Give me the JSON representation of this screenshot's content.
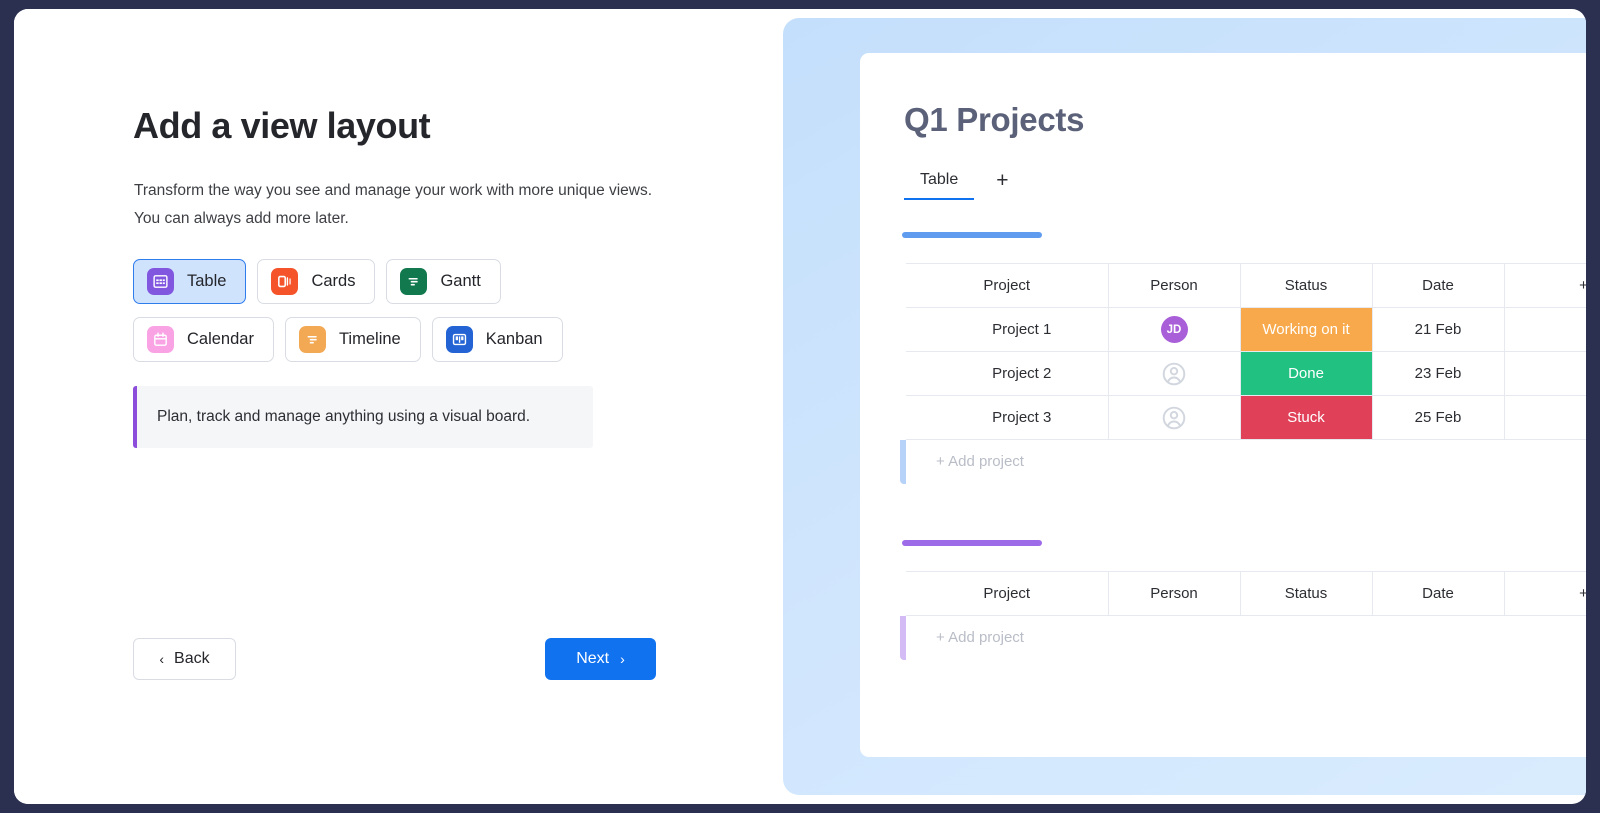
{
  "theme": {
    "frame_bg": "#2b3050",
    "accent_blue": "#1072ef",
    "selected_bg": "#cfe3fd",
    "callout_accent": "#8c4ddb"
  },
  "left": {
    "title": "Add a view layout",
    "subtitle": "Transform the way you see and manage your work with more unique views. You can always add more later.",
    "view_options": [
      {
        "label": "Table",
        "icon": "table-icon",
        "icon_color": "#8157e0",
        "selected": true
      },
      {
        "label": "Cards",
        "icon": "cards-icon",
        "icon_color": "#f5542b",
        "selected": false
      },
      {
        "label": "Gantt",
        "icon": "gantt-icon",
        "icon_color": "#12794e",
        "selected": false
      },
      {
        "label": "Calendar",
        "icon": "calendar-icon",
        "icon_color": "#f9a3e4",
        "selected": false
      },
      {
        "label": "Timeline",
        "icon": "timeline-icon",
        "icon_color": "#f3a854",
        "selected": false
      },
      {
        "label": "Kanban",
        "icon": "kanban-icon",
        "icon_color": "#2363d4",
        "selected": false
      }
    ],
    "callout": "Plan, track and manage anything using a visual board.",
    "back_label": "Back",
    "back_chevron": "‹",
    "next_label": "Next",
    "next_chevron": "›"
  },
  "preview": {
    "board_title": "Q1 Projects",
    "tabs": [
      {
        "label": "Table",
        "active": true
      }
    ],
    "add_tab_label": "+",
    "add_column_label": "+",
    "add_row_label": "+ Add project",
    "columns": [
      "Project",
      "Person",
      "Status",
      "Date"
    ],
    "groups": [
      {
        "color": "#5f9cf0",
        "rows": [
          {
            "project": "Project 1",
            "person": "JD",
            "person_type": "initials",
            "person_color": "#a85fd8",
            "status": "Working on it",
            "status_color": "#f7a94b",
            "date": "21 Feb"
          },
          {
            "project": "Project 2",
            "person": null,
            "person_type": "placeholder",
            "status": "Done",
            "status_color": "#21c182",
            "date": "23 Feb"
          },
          {
            "project": "Project 3",
            "person": null,
            "person_type": "placeholder",
            "status": "Stuck",
            "status_color": "#e04159",
            "date": "25 Feb"
          }
        ]
      },
      {
        "color": "#9d6ae8",
        "rows": []
      }
    ]
  }
}
